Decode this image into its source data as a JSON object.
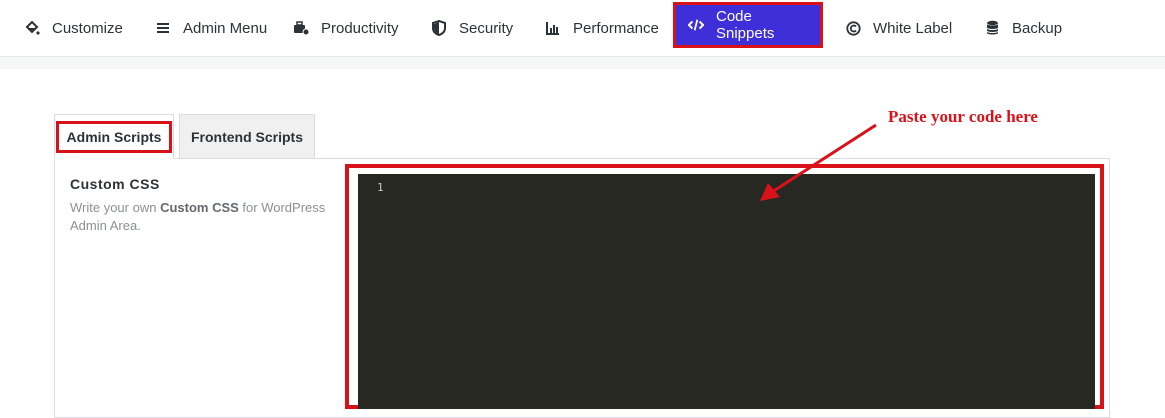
{
  "nav": {
    "items": [
      {
        "label": "Customize",
        "icon": "paint-bucket-icon"
      },
      {
        "label": "Admin Menu",
        "icon": "menu-lines-icon"
      },
      {
        "label": "Productivity",
        "icon": "toolbox-icon"
      },
      {
        "label": "Security",
        "icon": "shield-icon"
      },
      {
        "label": "Performance",
        "icon": "chart-icon"
      },
      {
        "label": "Code Snippets",
        "icon": "code-icon"
      },
      {
        "label": "White Label",
        "icon": "copyright-icon"
      },
      {
        "label": "Backup",
        "icon": "database-icon"
      }
    ],
    "active": "Code Snippets"
  },
  "tabs": {
    "admin": "Admin Scripts",
    "frontend": "Frontend Scripts"
  },
  "field": {
    "title": "Custom CSS",
    "desc_prefix": "Write your own ",
    "desc_bold": "Custom CSS",
    "desc_suffix": " for WordPress Admin Area."
  },
  "editor": {
    "line_number": "1"
  },
  "annotation": {
    "text": "Paste your code here"
  },
  "colors": {
    "accent": "#3f2fd9",
    "highlight": "#d9121a",
    "editor_bg": "#272822"
  }
}
